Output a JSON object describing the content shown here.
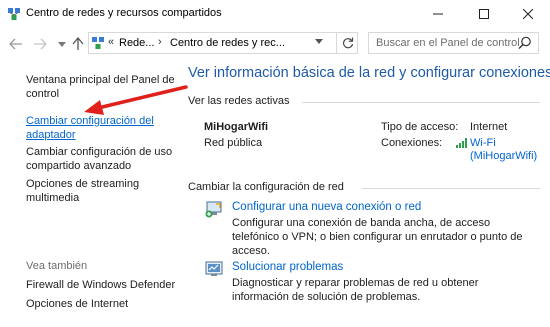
{
  "window": {
    "title": "Centro de redes y recursos compartidos",
    "icon": "network-center-icon"
  },
  "address": {
    "crumb_sep_start": "«",
    "crumbs": [
      "Rede...",
      "Centro de redes y rec..."
    ],
    "crumb_sep": "›",
    "search_placeholder": "Buscar en el Panel de control"
  },
  "sidebar": {
    "links": [
      {
        "label": "Ventana principal del Panel de control"
      },
      {
        "label": "Cambiar configuración del adaptador",
        "highlighted": true
      },
      {
        "label": "Cambiar configuración de uso compartido avanzado"
      },
      {
        "label": "Opciones de streaming multimedia"
      }
    ],
    "see_also_heading": "Vea también",
    "see_also": [
      {
        "label": "Firewall de Windows Defender"
      },
      {
        "label": "Opciones de Internet"
      }
    ]
  },
  "main": {
    "title": "Ver información básica de la red y configurar conexiones",
    "active_networks_heading": "Ver las redes activas",
    "network": {
      "name": "MiHogarWifi",
      "type": "Red pública",
      "access_type_label": "Tipo de acceso:",
      "access_type_value": "Internet",
      "connections_label": "Conexiones:",
      "connection_line1": "Wi-Fi",
      "connection_line2": "(MiHogarWifi)"
    },
    "change_settings_heading": "Cambiar la configuración de red",
    "tasks": [
      {
        "icon": "new-connection-icon",
        "label": "Configurar una nueva conexión o red",
        "desc": "Configurar una conexión de banda ancha, de acceso telefónico o VPN; o bien configurar un enrutador o punto de acceso."
      },
      {
        "icon": "troubleshoot-icon",
        "label": "Solucionar problemas",
        "desc": "Diagnosticar y reparar problemas de red u obtener información de solución de problemas."
      }
    ]
  },
  "colors": {
    "link_blue": "#0066cc",
    "title_blue": "#1e5aa8",
    "arrow_red": "#e0201b"
  }
}
